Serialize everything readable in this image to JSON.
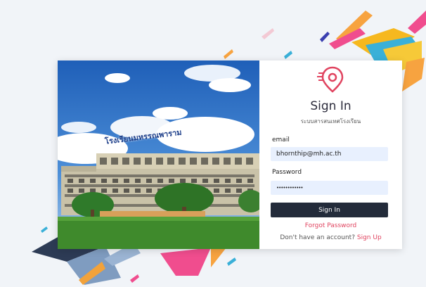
{
  "photo": {
    "sign_text": "โรงเรียนมหรรณพาราม"
  },
  "login": {
    "title": "Sign In",
    "subtitle": "ระบบสารสนเทศโรงเรียน",
    "email_label": "email",
    "email_value": "bhornthip@mh.ac.th",
    "password_label": "Password",
    "password_value": "••••••••••••",
    "signin_label": "Sign In",
    "forgot_label": "Forgot Password",
    "signup_prompt": "Don't have an account?",
    "signup_link": "Sign Up"
  },
  "colors": {
    "accent": "#e0435f",
    "button": "#232b3a",
    "field_bg": "#e8f0fe"
  },
  "icons": {
    "logo": "location-pin-icon"
  }
}
